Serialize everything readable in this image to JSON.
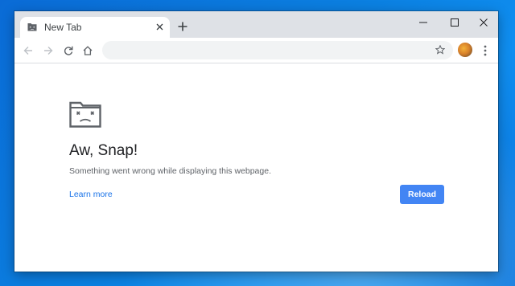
{
  "colors": {
    "desktop": "#0b7fe0",
    "titlebar": "#dee1e6",
    "accent": "#4285f4",
    "link": "#1a73e8"
  },
  "tab": {
    "title": "New Tab",
    "favicon": "sad-folder-icon",
    "close_icon": "close-icon"
  },
  "toolbar": {
    "address_value": "",
    "back_icon": "arrow-left-icon",
    "forward_icon": "arrow-right-icon",
    "reload_icon": "reload-icon",
    "home_icon": "home-icon",
    "bookmark_icon": "star-icon",
    "menu_icon": "kebab-menu-icon"
  },
  "window_controls": [
    "minimize-icon",
    "maximize-icon",
    "close-icon"
  ],
  "error_page": {
    "icon": "sad-folder-icon",
    "title": "Aw, Snap!",
    "message": "Something went wrong while displaying this webpage.",
    "learn_more": "Learn more",
    "reload_label": "Reload"
  }
}
